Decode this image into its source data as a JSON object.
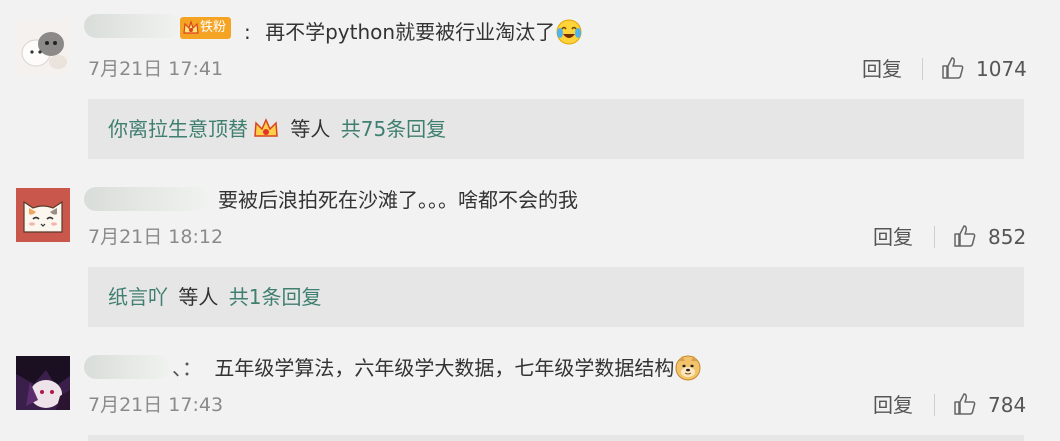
{
  "comments": [
    {
      "fan_badge": "铁粉",
      "separator": ":",
      "text": "再不学python就要被行业淘汰了",
      "emoji": "crying-laugh-emoji",
      "time": "7月21日 17:41",
      "reply_label": "回复",
      "likes": "1074",
      "replies": {
        "user": "你离拉生意顶替",
        "middle": "等人",
        "total": "共75条回复"
      }
    },
    {
      "text": "要被后浪拍死在沙滩了。。。啥都不会的我",
      "time": "7月21日 18:12",
      "reply_label": "回复",
      "likes": "852",
      "replies": {
        "user": "纸言吖",
        "middle": "等人",
        "total": "共1条回复"
      }
    },
    {
      "separator": "、：",
      "text": "五年级学算法，六年级学大数据，七年级学数据结构",
      "emoji": "doge-emoji",
      "time": "7月21日 17:43",
      "reply_label": "回复",
      "likes": "784"
    }
  ],
  "colors": {
    "background": "#f2f2f2",
    "reply_box": "#e6e6e6",
    "link": "#3f7f6f",
    "meta": "#8a8a8a",
    "badge": "#f5a323"
  }
}
